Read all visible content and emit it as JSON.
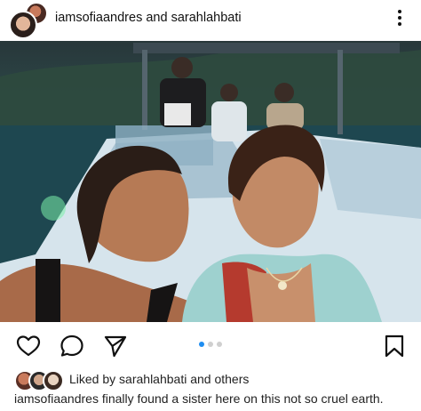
{
  "post": {
    "author_line": "iamsofiaandres and sarahlahbati",
    "liked_prefix": "Liked by",
    "liked_user": "sarahlahbati",
    "liked_and": "and",
    "liked_others": "others",
    "caption_user": "iamsofiaandres",
    "caption_text": "finally found a sister here on this not so cruel earth."
  },
  "carousel": {
    "current": 1,
    "total": 3
  },
  "icons": {
    "more": "more-vertical-icon",
    "like": "heart-icon",
    "comment": "comment-icon",
    "share": "send-icon",
    "save": "bookmark-icon"
  },
  "colors": {
    "carousel_active": "#1f8ef1",
    "carousel_inactive": "#cfcfcf"
  }
}
